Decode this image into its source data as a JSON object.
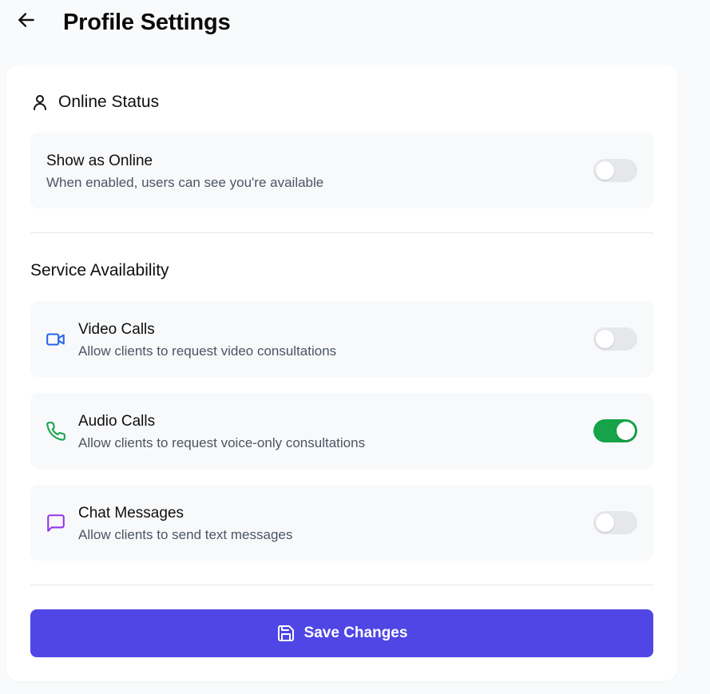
{
  "header": {
    "back_icon": "arrow-left-icon",
    "title": "Profile Settings"
  },
  "online_status": {
    "section_icon": "user-icon",
    "title": "Online Status",
    "show_online": {
      "label": "Show as Online",
      "description": "When enabled, users can see you're available",
      "enabled": false
    }
  },
  "service_availability": {
    "title": "Service Availability",
    "items": [
      {
        "icon": "video-camera-icon",
        "icon_color": "#2563eb",
        "label": "Video Calls",
        "description": "Allow clients to request video consultations",
        "enabled": false
      },
      {
        "icon": "phone-icon",
        "icon_color": "#16a34a",
        "label": "Audio Calls",
        "description": "Allow clients to request voice-only consultations",
        "enabled": true
      },
      {
        "icon": "chat-bubble-icon",
        "icon_color": "#9333ea",
        "label": "Chat Messages",
        "description": "Allow clients to send text messages",
        "enabled": false
      }
    ]
  },
  "actions": {
    "save_icon": "save-disk-icon",
    "save_label": "Save Changes"
  },
  "colors": {
    "primary": "#4f46e5",
    "toggle_on": "#16a34a",
    "toggle_off": "#e5e7eb",
    "page_background": "#f9fafb",
    "card_background": "#ffffff",
    "row_background": "#f8f9fb"
  }
}
